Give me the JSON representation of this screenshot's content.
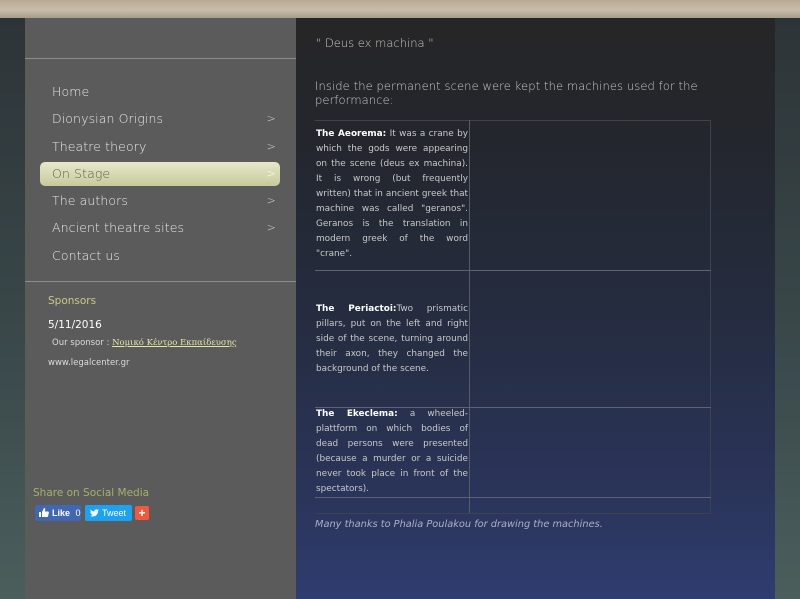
{
  "sidebar": {
    "nav": [
      {
        "label": "Home",
        "has_submenu": false,
        "active": false
      },
      {
        "label": "Dionysian Origins",
        "has_submenu": true,
        "active": false
      },
      {
        "label": "Theatre theory",
        "has_submenu": true,
        "active": false
      },
      {
        "label": "On Stage",
        "has_submenu": true,
        "active": true
      },
      {
        "label": "The authors",
        "has_submenu": true,
        "active": false
      },
      {
        "label": "Ancient theatre sites",
        "has_submenu": true,
        "active": false
      },
      {
        "label": "Contact us",
        "has_submenu": false,
        "active": false
      }
    ],
    "submenu_arrow": ">",
    "sponsors": {
      "title": "Sponsors",
      "date": "5/11/2016",
      "sponsor_prefix": "Our sponsor :",
      "sponsor_link": "Νομικό Κέντρο Εκπαίδευσης",
      "url": "www.legalcenter.gr"
    },
    "share": {
      "title": "Share on Social Media",
      "like_label": "Like",
      "like_count": "0",
      "tweet_label": "Tweet",
      "plus_label": "+"
    }
  },
  "main": {
    "heading": "\" Deus ex machina \"",
    "intro": "Inside the permanent scene were kept the machines used for the performance:",
    "machines": [
      {
        "term": "The Aeorema:",
        "text": " It was a crane by which the gods were appearing on the scene (deus ex machina). It is wrong (but frequently written) that in ancient greek that machine was called \"geranos\". Geranos is the translation in modern greek of the word \"crane\"."
      },
      {
        "term": "The Periactoi:",
        "text": "Two prismatic pillars, put on the left and right side of the scene, turning around their axon, they changed the background of the scene."
      },
      {
        "term": "The Ekeclema:",
        "text": " a wheeled-plattform on which bodies of dead persons were presented (because a murder or a suicide never took  place in front of the spectators)."
      }
    ],
    "thanks": "Many thanks to Phalia Poulakou for drawing the machines."
  },
  "colors": {
    "sidebar_bg": "#5b5b5b",
    "active_item": "#d8dab0",
    "sponsor_title": "#c8cb82",
    "main_bg_top": "#262626",
    "main_bg_bottom": "#2f3c6f",
    "facebook": "#4267b2",
    "twitter": "#1da1f2",
    "plus": "#f0593e"
  }
}
